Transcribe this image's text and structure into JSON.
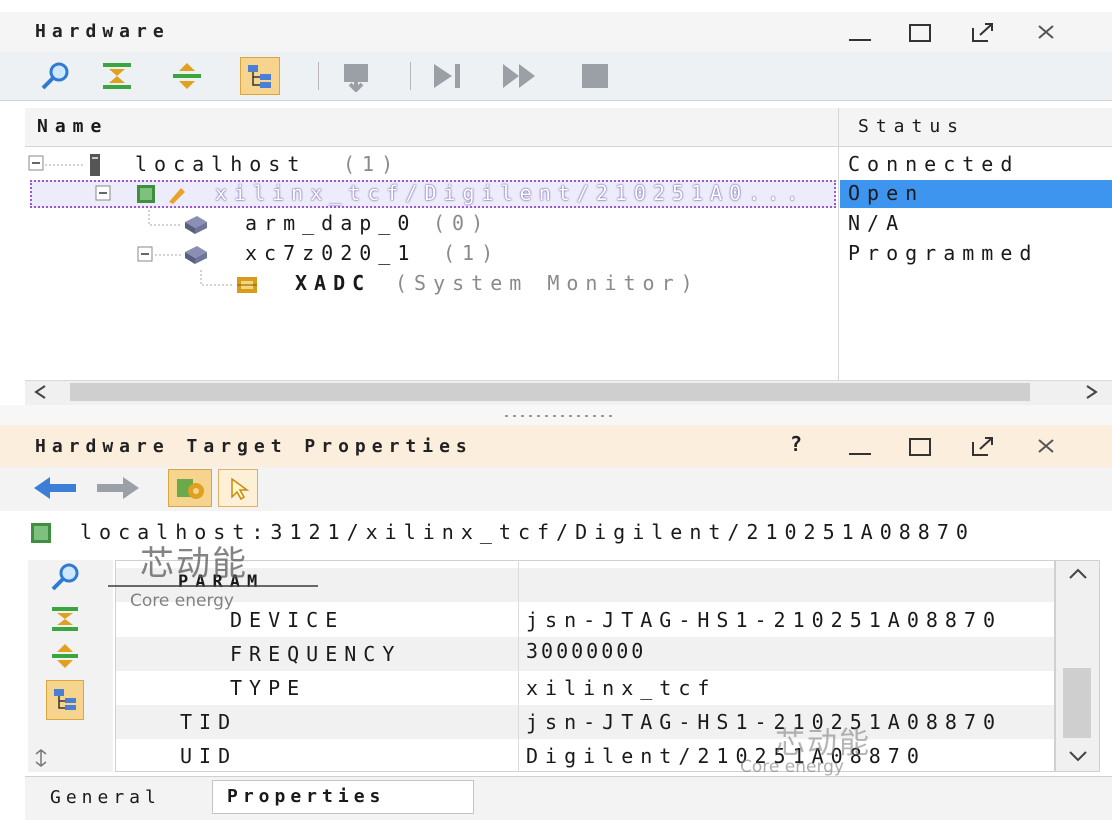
{
  "hardware_panel": {
    "title": "Hardware",
    "tree": {
      "columns": [
        "Name",
        "Status"
      ],
      "rows": [
        {
          "name": "localhost",
          "count": "(1)",
          "status": "Connected"
        },
        {
          "name": "xilinx_tcf/Digilent/210251A0...",
          "count": "",
          "status": "Open"
        },
        {
          "name": "arm_dap_0",
          "count": "(0)",
          "status": "N/A"
        },
        {
          "name": "xc7z020_1",
          "count": "(1)",
          "status": "Programmed"
        },
        {
          "name": "XADC",
          "count": "(System Monitor)",
          "status": ""
        }
      ],
      "selected_row": 1
    }
  },
  "properties_panel": {
    "title": "Hardware Target Properties",
    "help": "?",
    "path": "localhost:3121/xilinx_tcf/Digilent/210251A08870",
    "properties": [
      {
        "name": "PARAM",
        "value": ""
      },
      {
        "name": "DEVICE",
        "value": "jsn-JTAG-HS1-210251A08870"
      },
      {
        "name": "FREQUENCY",
        "value": "30000000"
      },
      {
        "name": "TYPE",
        "value": "xilinx_tcf"
      },
      {
        "name": "TID",
        "value": "jsn-JTAG-HS1-210251A08870"
      },
      {
        "name": "UID",
        "value": "Digilent/210251A08870"
      }
    ],
    "tabs": [
      {
        "label": "General",
        "active": false
      },
      {
        "label": "Properties",
        "active": true
      }
    ]
  },
  "watermarks": [
    {
      "cn": "芯动能",
      "en": "Core energy"
    },
    {
      "cn": "芯动能",
      "en": "Core energy"
    }
  ],
  "colors": {
    "selection": "#3d95ef",
    "selection_name_bg": "#ececfa",
    "active_title": "#fbeedd",
    "toggle_highlight": "#f6d48e"
  }
}
